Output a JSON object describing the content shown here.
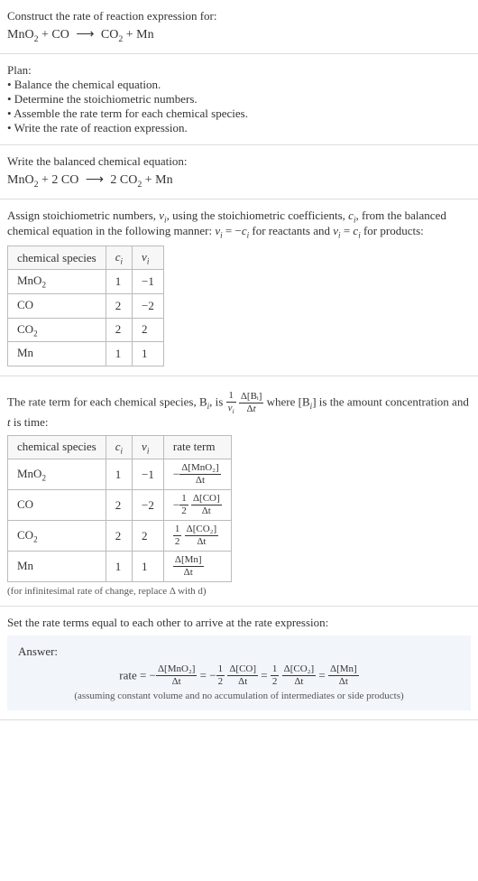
{
  "s1": {
    "heading": "Construct the rate of reaction expression for:",
    "eq_lhs1": "MnO",
    "eq_lhs1_sub": "2",
    "plus": " + ",
    "eq_lhs2": "CO",
    "arrow": "⟶",
    "eq_rhs1": "CO",
    "eq_rhs1_sub": "2",
    "eq_rhs2": "Mn"
  },
  "plan": {
    "heading": "Plan:",
    "items": [
      "• Balance the chemical equation.",
      "• Determine the stoichiometric numbers.",
      "• Assemble the rate term for each chemical species.",
      "• Write the rate of reaction expression."
    ]
  },
  "s3": {
    "heading": "Write the balanced chemical equation:",
    "lhs1": "MnO",
    "lhs1_sub": "2",
    "lhs2_coef": "2 ",
    "lhs2": "CO",
    "arrow": "⟶",
    "rhs1_coef": "2 ",
    "rhs1": "CO",
    "rhs1_sub": "2",
    "rhs2": "Mn"
  },
  "s4": {
    "text_a": "Assign stoichiometric numbers, ",
    "nu": "ν",
    "i": "i",
    "text_b": ", using the stoichiometric coefficients, ",
    "c": "c",
    "text_c": ", from the balanced chemical equation in the following manner: ",
    "rel1_a": "ν",
    "rel1_b": " = −",
    "rel1_c": "c",
    "text_d": " for reactants and ",
    "rel2_a": "ν",
    "rel2_b": " = ",
    "rel2_c": "c",
    "text_e": " for products:",
    "headers": [
      "chemical species",
      "cᵢ",
      "νᵢ"
    ],
    "rows": [
      {
        "sp": "MnO",
        "sp_sub": "2",
        "c": "1",
        "nu": "−1"
      },
      {
        "sp": "CO",
        "sp_sub": "",
        "c": "2",
        "nu": "−2"
      },
      {
        "sp": "CO",
        "sp_sub": "2",
        "c": "2",
        "nu": "2"
      },
      {
        "sp": "Mn",
        "sp_sub": "",
        "c": "1",
        "nu": "1"
      }
    ]
  },
  "s5": {
    "text_a": "The rate term for each chemical species, B",
    "text_b": ", is ",
    "frac1_num": "1",
    "frac1_den_a": "ν",
    "frac1_den_b": "i",
    "frac2_num": "Δ[Bᵢ]",
    "frac2_den": "Δt",
    "text_c": " where [B",
    "text_d": "] is the amount concentration and ",
    "tvar": "t",
    "text_e": " is time:",
    "headers": [
      "chemical species",
      "cᵢ",
      "νᵢ",
      "rate term"
    ],
    "rows": [
      {
        "sp": "MnO",
        "sp_sub": "2",
        "c": "1",
        "nu": "−1",
        "sign": "−",
        "coef_num": "",
        "coef_den": "",
        "d_num": "Δ[MnO₂]",
        "d_den": "Δt"
      },
      {
        "sp": "CO",
        "sp_sub": "",
        "c": "2",
        "nu": "−2",
        "sign": "−",
        "coef_num": "1",
        "coef_den": "2",
        "d_num": "Δ[CO]",
        "d_den": "Δt"
      },
      {
        "sp": "CO",
        "sp_sub": "2",
        "c": "2",
        "nu": "2",
        "sign": "",
        "coef_num": "1",
        "coef_den": "2",
        "d_num": "Δ[CO₂]",
        "d_den": "Δt"
      },
      {
        "sp": "Mn",
        "sp_sub": "",
        "c": "1",
        "nu": "1",
        "sign": "",
        "coef_num": "",
        "coef_den": "",
        "d_num": "Δ[Mn]",
        "d_den": "Δt"
      }
    ],
    "note": "(for infinitesimal rate of change, replace Δ with d)"
  },
  "s6": {
    "heading": "Set the rate terms equal to each other to arrive at the rate expression:",
    "answer_label": "Answer:",
    "rate_word": "rate = ",
    "eq": {
      "t1_sign": "−",
      "t1_num": "Δ[MnO₂]",
      "t1_den": "Δt",
      "eqs": " = ",
      "t2_sign": "−",
      "t2_cnum": "1",
      "t2_cden": "2",
      "t2_num": "Δ[CO]",
      "t2_den": "Δt",
      "t3_cnum": "1",
      "t3_cden": "2",
      "t3_num": "Δ[CO₂]",
      "t3_den": "Δt",
      "t4_num": "Δ[Mn]",
      "t4_den": "Δt"
    },
    "note": "(assuming constant volume and no accumulation of intermediates or side products)"
  }
}
